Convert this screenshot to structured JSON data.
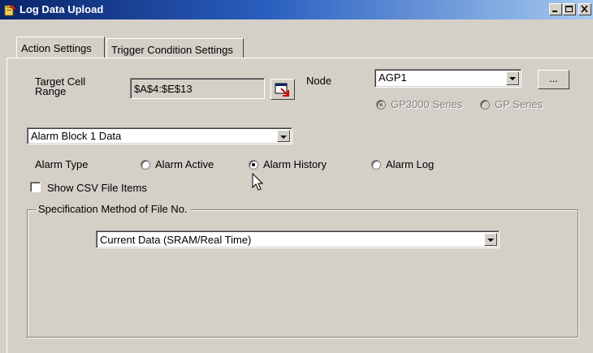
{
  "window": {
    "title": "Log Data Upload"
  },
  "tabs": [
    {
      "label": "Action Settings"
    },
    {
      "label": "Trigger Condition Settings"
    }
  ],
  "target_cell_range": {
    "label": "Target Cell\nRange",
    "value": "$A$4:$E$13"
  },
  "node": {
    "label": "Node",
    "value": "AGP1",
    "browse_label": "...",
    "series_options": [
      {
        "label": "GP3000 Series",
        "selected": true,
        "enabled": false
      },
      {
        "label": "GP Series",
        "selected": false,
        "enabled": false
      }
    ]
  },
  "data_select": {
    "value": "Alarm Block 1 Data"
  },
  "alarm_type": {
    "label": "Alarm Type",
    "options": [
      {
        "label": "Alarm Active",
        "selected": false
      },
      {
        "label": "Alarm History",
        "selected": true
      },
      {
        "label": "Alarm Log",
        "selected": false
      }
    ]
  },
  "show_csv": {
    "label": "Show CSV File Items",
    "checked": false
  },
  "file_no": {
    "title": "Specification Method of File No.",
    "value": "Current Data (SRAM/Real Time)"
  }
}
